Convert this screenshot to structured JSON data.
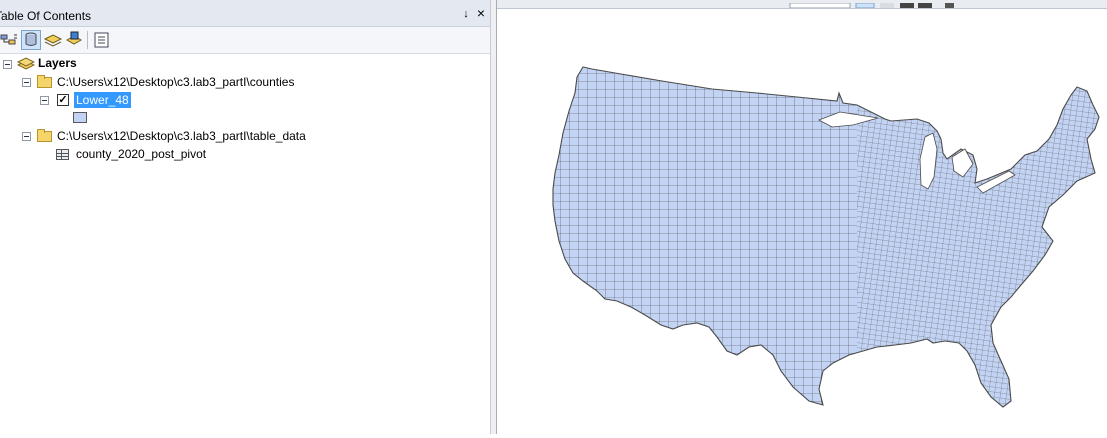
{
  "toc": {
    "title": "Table Of Contents",
    "pin_glyph": "↕",
    "close_glyph": "×",
    "toolbar": [
      {
        "name": "list-by-drawing-order-icon"
      },
      {
        "name": "list-by-source-icon",
        "active": true
      },
      {
        "name": "list-by-visibility-icon"
      },
      {
        "name": "list-by-selection-icon"
      },
      {
        "name": "options-icon"
      }
    ],
    "tree": {
      "root_label": "Layers",
      "groups": [
        {
          "path": "C:\\Users\\x12\\Desktop\\c3.lab3_partI\\counties",
          "layer": {
            "name": "Lower_48",
            "checked": true,
            "checkmark": "✓",
            "symbol_color": "#c3d3f4"
          }
        },
        {
          "path": "C:\\Users\\x12\\Desktop\\c3.lab3_partI\\table_data",
          "table": {
            "name": "county_2020_post_pivot"
          }
        }
      ]
    }
  },
  "map": {
    "layer_name": "Lower_48",
    "fill_color": "#c3d3f4",
    "outline_color": "#4a4a4a"
  }
}
